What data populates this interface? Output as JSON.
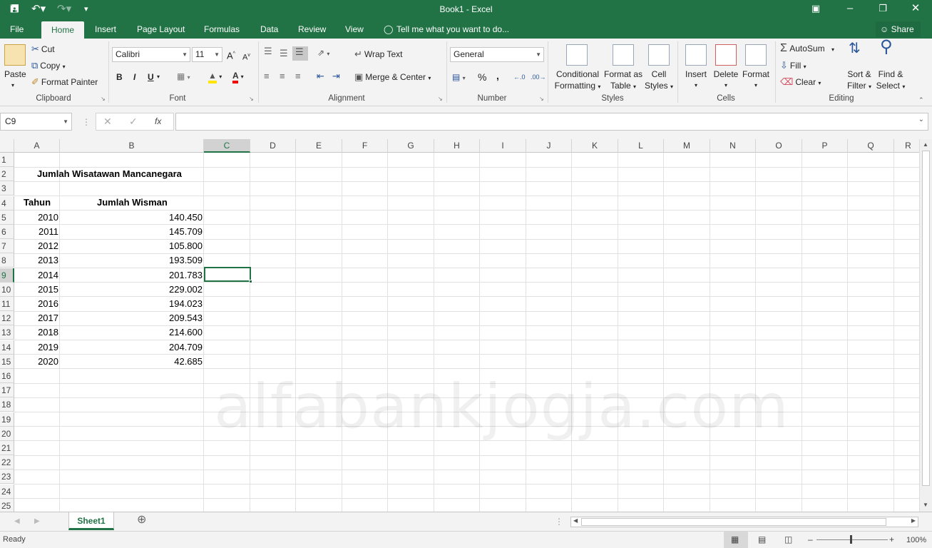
{
  "window": {
    "title": "Book1 - Excel"
  },
  "qat": {
    "save_icon": "save-icon",
    "undo_icon": "undo-icon",
    "redo_icon": "redo-icon"
  },
  "tabs": {
    "file": "File",
    "home": "Home",
    "insert": "Insert",
    "page_layout": "Page Layout",
    "formulas": "Formulas",
    "data": "Data",
    "review": "Review",
    "view": "View",
    "tell_me": "Tell me what you want to do...",
    "share": "Share"
  },
  "ribbon": {
    "clipboard": {
      "paste": "Paste",
      "cut": "Cut",
      "copy": "Copy",
      "format_painter": "Format Painter",
      "label": "Clipboard"
    },
    "font": {
      "name": "Calibri",
      "size": "11",
      "bold": "B",
      "italic": "I",
      "underline": "U",
      "grow": "A",
      "shrink": "A",
      "label": "Font"
    },
    "alignment": {
      "wrap_text": "Wrap Text",
      "merge_center": "Merge & Center",
      "label": "Alignment"
    },
    "number": {
      "format": "General",
      "percent": "%",
      "comma": ",",
      "label": "Number"
    },
    "styles": {
      "conditional": "Conditional",
      "conditional2": "Formatting",
      "format_as": "Format as",
      "format_as2": "Table",
      "cell": "Cell",
      "cell2": "Styles",
      "label": "Styles"
    },
    "cells": {
      "insert": "Insert",
      "delete": "Delete",
      "format": "Format",
      "label": "Cells"
    },
    "editing": {
      "autosum": "AutoSum",
      "fill": "Fill",
      "clear": "Clear",
      "sort": "Sort &",
      "sort2": "Filter",
      "find": "Find &",
      "find2": "Select",
      "label": "Editing"
    }
  },
  "formula_bar": {
    "name_box": "C9",
    "fx": "fx",
    "value": ""
  },
  "columns": [
    "A",
    "B",
    "C",
    "D",
    "E",
    "F",
    "G",
    "H",
    "I",
    "J",
    "K",
    "L",
    "M",
    "N",
    "O",
    "P",
    "Q",
    "R"
  ],
  "rows": [
    "1",
    "2",
    "3",
    "4",
    "5",
    "6",
    "7",
    "8",
    "9",
    "10",
    "11",
    "12",
    "13",
    "14",
    "15",
    "16",
    "17",
    "18",
    "19",
    "20",
    "21",
    "22",
    "23",
    "24",
    "25"
  ],
  "sheet": {
    "title": "Jumlah Wisatawan Mancanegara",
    "header_year": "Tahun",
    "header_count": "Jumlah Wisman",
    "data": [
      {
        "year": "2010",
        "value": "140.450"
      },
      {
        "year": "2011",
        "value": "145.709"
      },
      {
        "year": "2012",
        "value": "105.800"
      },
      {
        "year": "2013",
        "value": "193.509"
      },
      {
        "year": "2014",
        "value": "201.783"
      },
      {
        "year": "2015",
        "value": "229.002"
      },
      {
        "year": "2016",
        "value": "194.023"
      },
      {
        "year": "2017",
        "value": "209.543"
      },
      {
        "year": "2018",
        "value": "214.600"
      },
      {
        "year": "2019",
        "value": "204.709"
      },
      {
        "year": "2020",
        "value": "42.685"
      }
    ]
  },
  "watermark": "alfabankjogja.com",
  "sheet_tabs": {
    "active": "Sheet1"
  },
  "status": {
    "ready": "Ready",
    "zoom": "100%"
  },
  "colors": {
    "excel_green": "#217346",
    "ribbon_bg": "#f3f3f3",
    "grid_line": "#e1e1e1"
  }
}
